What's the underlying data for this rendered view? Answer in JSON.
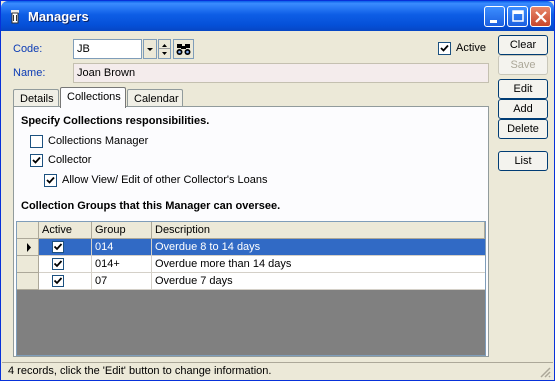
{
  "window": {
    "title": "Managers"
  },
  "form": {
    "code_label": "Code:",
    "code_value": "JB",
    "name_label": "Name:",
    "name_value": "Joan Brown",
    "active_label": "Active",
    "active_checked": true
  },
  "buttons": {
    "clear": "Clear",
    "save": "Save",
    "edit": "Edit",
    "add": "Add",
    "delete": "Delete",
    "list": "List"
  },
  "tabs": [
    {
      "label": "Details"
    },
    {
      "label": "Collections",
      "active": true
    },
    {
      "label": "Calendar"
    }
  ],
  "collections": {
    "responsibilities_title": "Specify Collections responsibilities.",
    "manager_label": "Collections Manager",
    "manager_checked": false,
    "collector_label": "Collector",
    "collector_checked": true,
    "allow_label": "Allow View/ Edit of other Collector's Loans",
    "allow_checked": true,
    "groups_title": "Collection Groups that this Manager can oversee."
  },
  "grid": {
    "columns": [
      "Active",
      "Group",
      "Description"
    ],
    "rows": [
      {
        "active": true,
        "group": "014",
        "description": "Overdue 8 to 14 days",
        "selected": true
      },
      {
        "active": true,
        "group": "014+",
        "description": "Overdue more than 14 days",
        "selected": false
      },
      {
        "active": true,
        "group": "07",
        "description": "Overdue 7 days",
        "selected": false
      }
    ]
  },
  "status": {
    "text": "4 records, click the 'Edit' button to change information."
  },
  "colors": {
    "title_blue": "#0A5FE8",
    "selection": "#316AC5",
    "label_blue": "#0B3BB5"
  },
  "icons": [
    "app-icon",
    "minimize-icon",
    "maximize-icon",
    "close-icon",
    "binoculars-icon",
    "dropdown-arrow-icon",
    "row-pointer-icon",
    "checkmark-icon",
    "resize-grip-icon"
  ]
}
